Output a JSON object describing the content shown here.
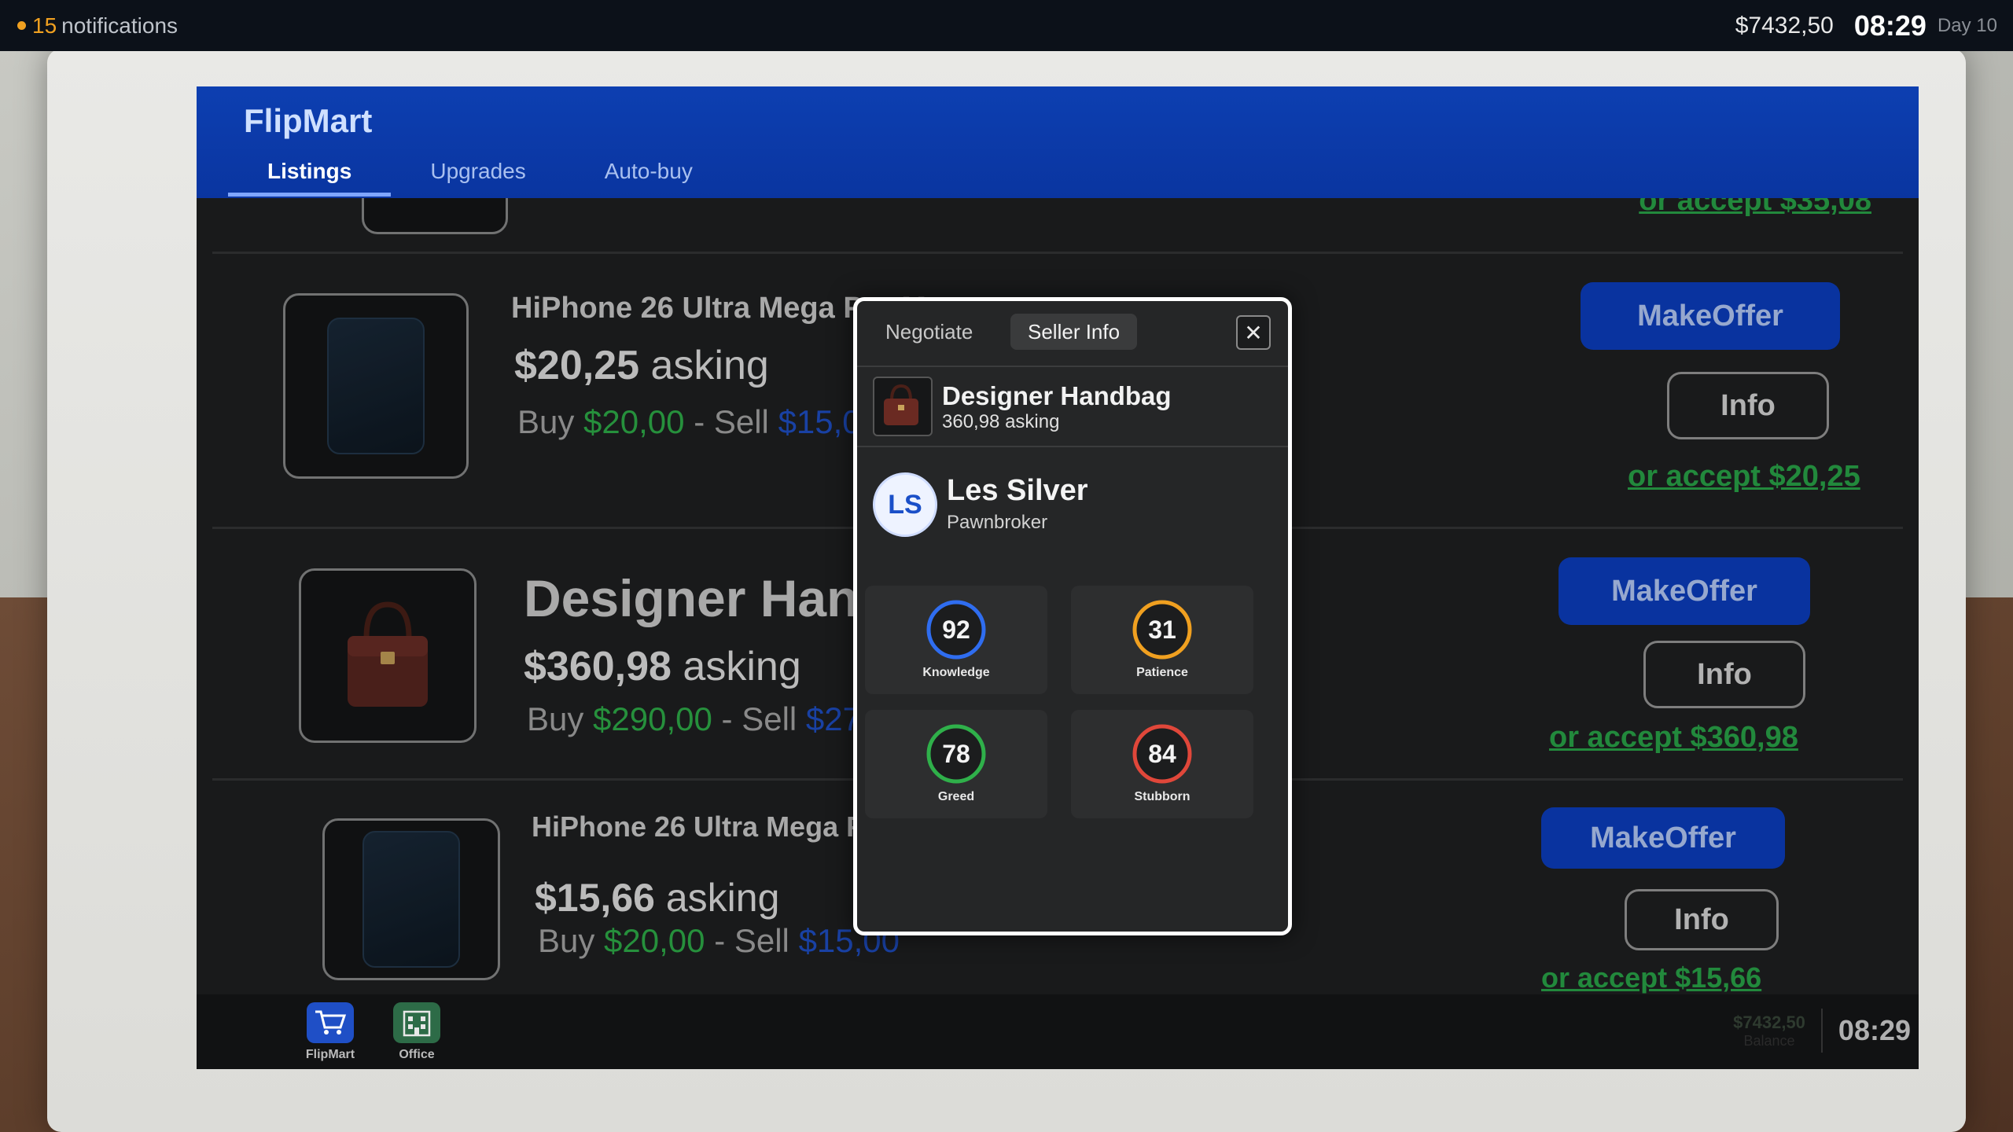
{
  "status_bar": {
    "notification_count": "15",
    "notification_label": "notifications",
    "balance": "$7432,50",
    "time": "08:29",
    "day": "Day 10"
  },
  "app": {
    "title": "FlipMart",
    "tabs": [
      {
        "label": "Listings",
        "active": true
      },
      {
        "label": "Upgrades",
        "active": false
      },
      {
        "label": "Auto-buy",
        "active": false
      }
    ]
  },
  "listings": [
    {
      "name": "HiPhone 26 Ultra Mega Pro Max",
      "asking_price": "$20,25",
      "asking_word": "asking",
      "buy_word": "Buy",
      "buy_price": "$20,00",
      "sell_word": "- Sell",
      "sell_price": "$15,00",
      "offer_label": "MakeOffer",
      "info_label": "Info",
      "accept_label": "or accept $20,25"
    },
    {
      "name": "Designer Handbag",
      "asking_price": "$360,98",
      "asking_word": "asking",
      "buy_word": "Buy",
      "buy_price": "$290,00",
      "sell_word": "- Sell",
      "sell_price": "$270,00",
      "offer_label": "MakeOffer",
      "info_label": "Info",
      "accept_label": "or accept $360,98"
    },
    {
      "name": "HiPhone 26 Ultra Mega Pro Max",
      "asking_price": "$15,66",
      "asking_word": "asking",
      "buy_word": "Buy",
      "buy_price": "$20,00",
      "sell_word": "- Sell",
      "sell_price": "$15,00",
      "offer_label": "MakeOffer",
      "info_label": "Info",
      "accept_label": "or accept $15,66"
    }
  ],
  "partial_top_accept": "or accept $35,08",
  "dock": {
    "items": [
      {
        "label": "FlipMart",
        "icon": "cart-icon"
      },
      {
        "label": "Office",
        "icon": "office-building-icon"
      }
    ],
    "balance": "$7432,50",
    "balance_label": "Balance",
    "time": "08:29"
  },
  "modal": {
    "tabs": [
      {
        "label": "Negotiate",
        "active": false
      },
      {
        "label": "Seller Info",
        "active": true
      }
    ],
    "close_icon": "close-icon",
    "item_title": "Designer Handbag",
    "item_subtitle": "360,98 asking",
    "seller": {
      "initials": "LS",
      "name": "Les Silver",
      "role": "Pawnbroker"
    },
    "stats": [
      {
        "label": "Knowledge",
        "value": "92",
        "color": "#2f6df0"
      },
      {
        "label": "Patience",
        "value": "31",
        "color": "#f0a020"
      },
      {
        "label": "Greed",
        "value": "78",
        "color": "#2fb04a"
      },
      {
        "label": "Stubborn",
        "value": "84",
        "color": "#e0473a"
      }
    ]
  }
}
